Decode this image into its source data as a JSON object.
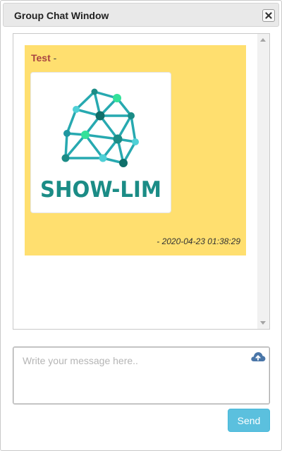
{
  "window": {
    "title": "Group Chat Window",
    "close_icon": "close-icon"
  },
  "messages": [
    {
      "sender": "Test",
      "separator": "-",
      "attachment": {
        "type": "image",
        "logo_text": "SHOW-LIM"
      },
      "timestamp": "- 2020-04-23 01:38:29"
    }
  ],
  "composer": {
    "placeholder": "Write your message here..",
    "upload_icon": "cloud-upload-icon",
    "send_label": "Send"
  },
  "colors": {
    "message_bg": "#ffdf6f",
    "sender": "#a94442",
    "send_button": "#5bc0de",
    "logo_teal": "#1b8c86",
    "logo_node_green": "#33e19a"
  }
}
